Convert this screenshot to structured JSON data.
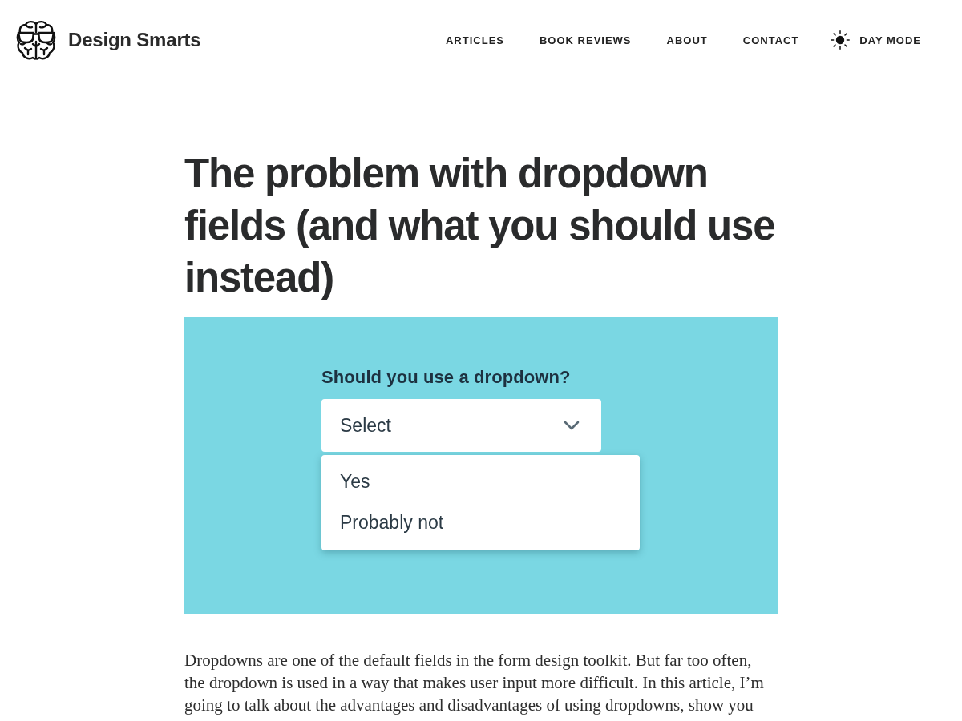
{
  "site": {
    "name": "Design Smarts"
  },
  "nav": {
    "items": [
      {
        "label": "ARTICLES"
      },
      {
        "label": "BOOK REVIEWS"
      },
      {
        "label": "ABOUT"
      },
      {
        "label": "CONTACT"
      }
    ],
    "theme_toggle": {
      "label": "DAY MODE"
    }
  },
  "article": {
    "title": "The problem with dropdown fields (and what you should use instead)",
    "illustration": {
      "question": "Should you use a dropdown?",
      "select": {
        "placeholder": "Select",
        "expanded": true
      },
      "options": [
        {
          "label": "Yes",
          "selected": false
        },
        {
          "label": "Probably not",
          "selected": false
        }
      ]
    },
    "paragraph": "Dropdowns are one of the default fields in the form design toolkit. But far too often, the dropdown is used in a way that makes user input more difficult. In this article, I’m going to talk about the advantages and disadvantages of using dropdowns, show you"
  }
}
